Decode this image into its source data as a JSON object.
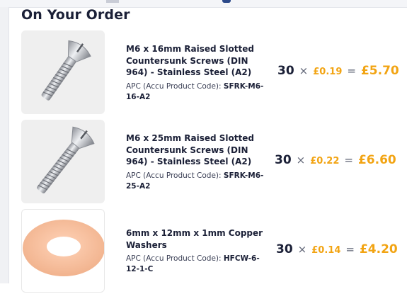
{
  "page": {
    "heading": "On Your Order"
  },
  "items": [
    {
      "title": "M6 x 16mm Raised Slotted Countersunk Screws (DIN 964) - Stainless Steel (A2)",
      "code_label": "APC (Accu Product Code):",
      "code": "SFRK-M6-16-A2",
      "quantity": "30",
      "unit_price": "£0.19",
      "total": "£5.70",
      "icon": "screw-image"
    },
    {
      "title": "M6 x 25mm Raised Slotted Countersunk Screws (DIN 964) - Stainless Steel (A2)",
      "code_label": "APC (Accu Product Code):",
      "code": "SFRK-M6-25-A2",
      "quantity": "30",
      "unit_price": "£0.22",
      "total": "£6.60",
      "icon": "screw-image"
    },
    {
      "title": "6mm x 12mm x 1mm Copper Washers",
      "code_label": "APC (Accu Product Code):",
      "code": "HFCW-6-12-1-C",
      "quantity": "30",
      "unit_price": "£0.14",
      "total": "£4.20",
      "icon": "washer-image"
    }
  ],
  "symbols": {
    "times": "×",
    "equals": "="
  },
  "colors": {
    "accent": "#f2a413",
    "text": "#1b2037"
  }
}
